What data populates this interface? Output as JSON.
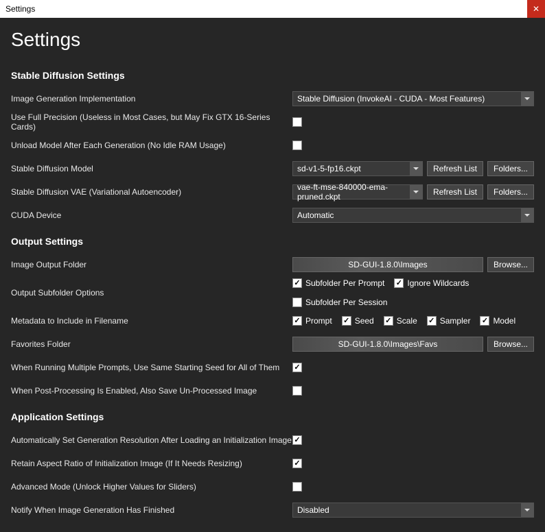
{
  "titlebar": {
    "title": "Settings"
  },
  "heading": "Settings",
  "sections": {
    "sd": {
      "title": "Stable Diffusion Settings",
      "impl_label": "Image Generation Implementation",
      "impl_value": "Stable Diffusion (InvokeAI - CUDA - Most Features)",
      "full_precision_label": "Use Full Precision (Useless in Most Cases, but May Fix GTX 16-Series Cards)",
      "unload_label": "Unload Model After Each Generation (No Idle RAM Usage)",
      "model_label": "Stable Diffusion Model",
      "model_value": "sd-v1-5-fp16.ckpt",
      "vae_label": "Stable Diffusion VAE (Variational Autoencoder)",
      "vae_value": "vae-ft-mse-840000-ema-pruned.ckpt",
      "cuda_label": "CUDA Device",
      "cuda_value": "Automatic",
      "refresh_btn": "Refresh List",
      "folders_btn": "Folders..."
    },
    "output": {
      "title": "Output Settings",
      "folder_label": "Image Output Folder",
      "folder_value": "SD-GUI-1.8.0\\Images",
      "browse_btn": "Browse...",
      "subfolder_label": "Output Subfolder Options",
      "subfolder_opts": {
        "per_prompt": "Subfolder Per Prompt",
        "ignore_wildcards": "Ignore Wildcards",
        "per_session": "Subfolder Per Session"
      },
      "metadata_label": "Metadata to Include in Filename",
      "metadata_opts": {
        "prompt": "Prompt",
        "seed": "Seed",
        "scale": "Scale",
        "sampler": "Sampler",
        "model": "Model"
      },
      "favs_label": "Favorites Folder",
      "favs_value": "SD-GUI-1.8.0\\Images\\Favs",
      "same_seed_label": "When Running Multiple Prompts, Use Same Starting Seed for All of Them",
      "postproc_label": "When Post-Processing Is Enabled, Also Save Un-Processed Image"
    },
    "app": {
      "title": "Application Settings",
      "auto_res_label": "Automatically Set Generation Resolution After Loading an Initialization Image",
      "aspect_label": "Retain Aspect Ratio of Initialization Image (If It Needs Resizing)",
      "advanced_label": "Advanced Mode (Unlock Higher Values for Sliders)",
      "notify_label": "Notify When Image Generation Has Finished",
      "notify_value": "Disabled"
    }
  }
}
